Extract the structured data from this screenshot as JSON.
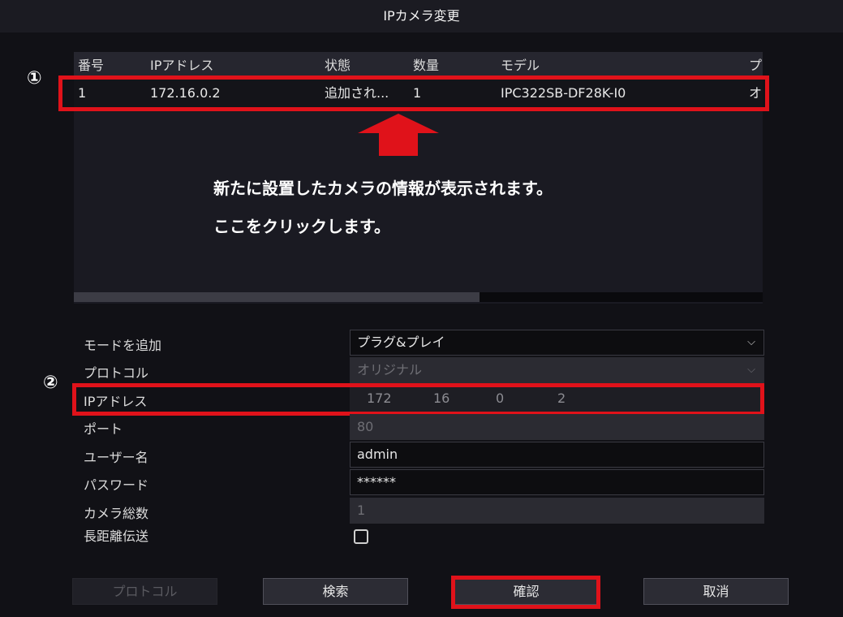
{
  "window": {
    "title": "IPカメラ変更"
  },
  "table": {
    "columns": [
      "番号",
      "IPアドレス",
      "状態",
      "数量",
      "モデル",
      "プ"
    ],
    "rows": [
      {
        "no": "1",
        "ip": "172.16.0.2",
        "status": "追加され...",
        "qty": "1",
        "model": "IPC322SB-DF28K-I0",
        "p": "オ"
      }
    ]
  },
  "annotations": {
    "marker1": "①",
    "marker2": "②",
    "line1": "新たに設置したカメラの情報が表示されます。",
    "line2": "ここをクリックします。",
    "highlight_color": "#e0121a"
  },
  "form": {
    "add_mode": {
      "label": "モードを追加",
      "value": "プラグ&プレイ"
    },
    "protocol": {
      "label": "プロトコル",
      "value": "オリジナル"
    },
    "ip": {
      "label": "IPアドレス",
      "segments": [
        "172",
        "16",
        "0",
        "2"
      ]
    },
    "port": {
      "label": "ポート",
      "value": "80"
    },
    "username": {
      "label": "ユーザー名",
      "value": "admin"
    },
    "password": {
      "label": "パスワード",
      "value": "******"
    },
    "camera_total": {
      "label": "カメラ総数",
      "value": "1"
    },
    "long_distance": {
      "label": "長距離伝送",
      "checked": false
    }
  },
  "buttons": {
    "protocol": "プロトコル",
    "search": "検索",
    "confirm": "確認",
    "cancel": "取消"
  },
  "icons": {
    "dropdown": "chevron-down-icon",
    "arrow": "up-arrow-icon"
  }
}
